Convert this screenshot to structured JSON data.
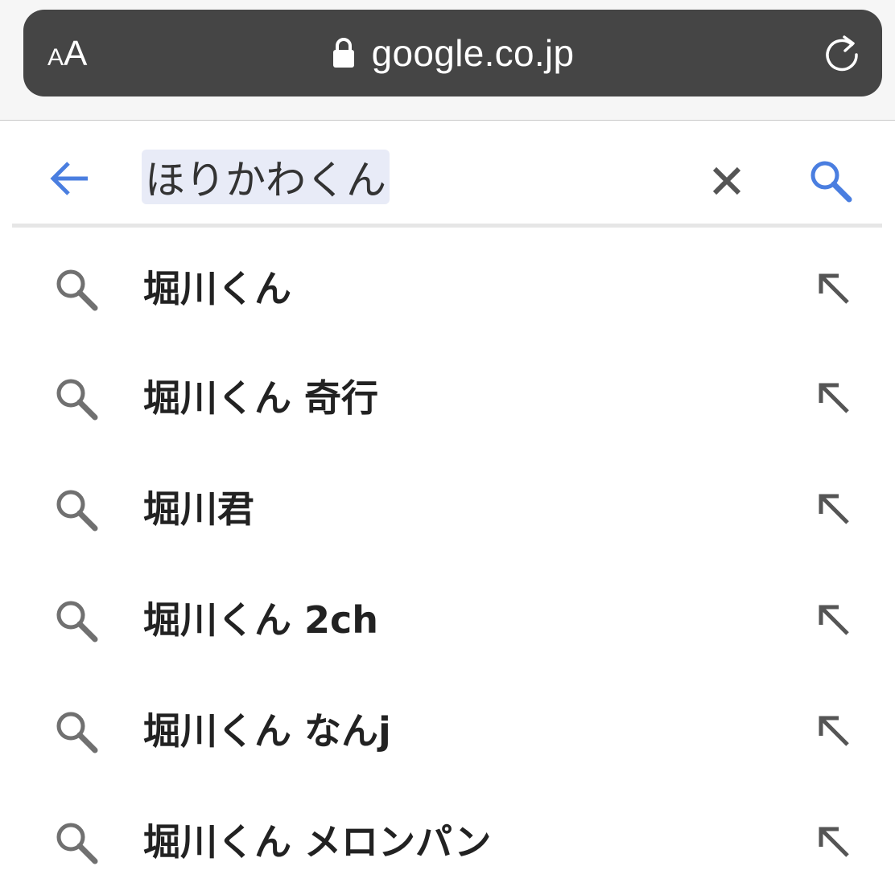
{
  "browser": {
    "text_size_small": "A",
    "text_size_large": "A",
    "url": "google.co.jp",
    "lock_icon": "lock-icon",
    "reload_icon": "reload-icon"
  },
  "search": {
    "query": "ほりかわくん",
    "back_icon": "arrow-left-icon",
    "clear_icon": "close-icon",
    "submit_icon": "search-icon",
    "accent_color": "#4a7ee0"
  },
  "suggestions": [
    {
      "text": "堀川くん"
    },
    {
      "text": "堀川くん 奇行"
    },
    {
      "text": "堀川君"
    },
    {
      "text": "堀川くん 2ch"
    },
    {
      "text": "堀川くん なんj"
    },
    {
      "text": "堀川くん メロンパン"
    }
  ]
}
